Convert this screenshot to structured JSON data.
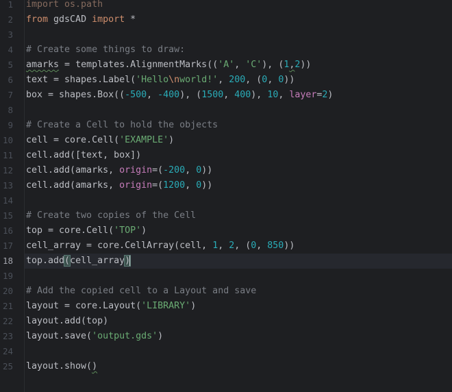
{
  "editor": {
    "current_line": 18,
    "lines": [
      {
        "n": "1",
        "tokens": [
          {
            "t": "import os.path",
            "c": "kw-soft"
          }
        ]
      },
      {
        "n": "2",
        "tokens": [
          {
            "t": "from",
            "c": "kw"
          },
          {
            "t": " gdsCAD ",
            "c": ""
          },
          {
            "t": "import",
            "c": "kw"
          },
          {
            "t": " *",
            "c": ""
          }
        ]
      },
      {
        "n": "3",
        "tokens": []
      },
      {
        "n": "4",
        "tokens": [
          {
            "t": "# Create some things to draw:",
            "c": "cmt"
          }
        ]
      },
      {
        "n": "5",
        "tokens": [
          {
            "t": "amarks",
            "c": "squig"
          },
          {
            "t": " = templates.AlignmentMarks((",
            "c": ""
          },
          {
            "t": "'A'",
            "c": "str"
          },
          {
            "t": ", ",
            "c": ""
          },
          {
            "t": "'C'",
            "c": "str"
          },
          {
            "t": "), (",
            "c": ""
          },
          {
            "t": "1",
            "c": "num"
          },
          {
            "t": ",",
            "c": "squig"
          },
          {
            "t": "2",
            "c": "num"
          },
          {
            "t": "))",
            "c": ""
          }
        ]
      },
      {
        "n": "6",
        "tokens": [
          {
            "t": "text = shapes.Label(",
            "c": ""
          },
          {
            "t": "'Hello",
            "c": "str"
          },
          {
            "t": "\\n",
            "c": "esc"
          },
          {
            "t": "world!'",
            "c": "str"
          },
          {
            "t": ", ",
            "c": ""
          },
          {
            "t": "200",
            "c": "num"
          },
          {
            "t": ", (",
            "c": ""
          },
          {
            "t": "0",
            "c": "num"
          },
          {
            "t": ", ",
            "c": ""
          },
          {
            "t": "0",
            "c": "num"
          },
          {
            "t": "))",
            "c": ""
          }
        ]
      },
      {
        "n": "7",
        "tokens": [
          {
            "t": "box = shapes.Box((",
            "c": ""
          },
          {
            "t": "-500",
            "c": "num"
          },
          {
            "t": ", ",
            "c": ""
          },
          {
            "t": "-400",
            "c": "num"
          },
          {
            "t": "), (",
            "c": ""
          },
          {
            "t": "1500",
            "c": "num"
          },
          {
            "t": ", ",
            "c": ""
          },
          {
            "t": "400",
            "c": "num"
          },
          {
            "t": "), ",
            "c": ""
          },
          {
            "t": "10",
            "c": "num"
          },
          {
            "t": ", ",
            "c": ""
          },
          {
            "t": "layer",
            "c": "param"
          },
          {
            "t": "=",
            "c": ""
          },
          {
            "t": "2",
            "c": "num"
          },
          {
            "t": ")",
            "c": ""
          }
        ]
      },
      {
        "n": "8",
        "tokens": []
      },
      {
        "n": "9",
        "tokens": [
          {
            "t": "# Create a Cell to hold the objects",
            "c": "cmt"
          }
        ]
      },
      {
        "n": "10",
        "tokens": [
          {
            "t": "cell = core.Cell(",
            "c": ""
          },
          {
            "t": "'EXAMPLE'",
            "c": "str"
          },
          {
            "t": ")",
            "c": ""
          }
        ]
      },
      {
        "n": "11",
        "tokens": [
          {
            "t": "cell.add([text, box])",
            "c": ""
          }
        ]
      },
      {
        "n": "12",
        "tokens": [
          {
            "t": "cell.add(amarks, ",
            "c": ""
          },
          {
            "t": "origin",
            "c": "param"
          },
          {
            "t": "=(",
            "c": ""
          },
          {
            "t": "-200",
            "c": "num"
          },
          {
            "t": ", ",
            "c": ""
          },
          {
            "t": "0",
            "c": "num"
          },
          {
            "t": "))",
            "c": ""
          }
        ]
      },
      {
        "n": "13",
        "tokens": [
          {
            "t": "cell.add(amarks, ",
            "c": ""
          },
          {
            "t": "origin",
            "c": "param"
          },
          {
            "t": "=(",
            "c": ""
          },
          {
            "t": "1200",
            "c": "num"
          },
          {
            "t": ", ",
            "c": ""
          },
          {
            "t": "0",
            "c": "num"
          },
          {
            "t": "))",
            "c": ""
          }
        ]
      },
      {
        "n": "14",
        "tokens": []
      },
      {
        "n": "15",
        "tokens": [
          {
            "t": "# Create two copies of the Cell",
            "c": "cmt"
          }
        ]
      },
      {
        "n": "16",
        "tokens": [
          {
            "t": "top = core.Cell(",
            "c": ""
          },
          {
            "t": "'TOP'",
            "c": "str"
          },
          {
            "t": ")",
            "c": ""
          }
        ]
      },
      {
        "n": "17",
        "tokens": [
          {
            "t": "cell_array = core.CellArray(cell, ",
            "c": ""
          },
          {
            "t": "1",
            "c": "num"
          },
          {
            "t": ", ",
            "c": ""
          },
          {
            "t": "2",
            "c": "num"
          },
          {
            "t": ", (",
            "c": ""
          },
          {
            "t": "0",
            "c": "num"
          },
          {
            "t": ", ",
            "c": ""
          },
          {
            "t": "850",
            "c": "num"
          },
          {
            "t": "))",
            "c": ""
          }
        ]
      },
      {
        "n": "18",
        "tokens": [
          {
            "t": "top.add",
            "c": ""
          },
          {
            "t": "(",
            "c": "bracket-match"
          },
          {
            "t": "cell_array",
            "c": ""
          },
          {
            "t": ")",
            "c": "bracket-match"
          },
          {
            "t": "",
            "c": "caret"
          }
        ]
      },
      {
        "n": "19",
        "tokens": []
      },
      {
        "n": "20",
        "tokens": [
          {
            "t": "# Add the copied cell to a Layout and save",
            "c": "cmt"
          }
        ]
      },
      {
        "n": "21",
        "tokens": [
          {
            "t": "layout = core.Layout(",
            "c": ""
          },
          {
            "t": "'LIBRARY'",
            "c": "str"
          },
          {
            "t": ")",
            "c": ""
          }
        ]
      },
      {
        "n": "22",
        "tokens": [
          {
            "t": "layout.add(top)",
            "c": ""
          }
        ]
      },
      {
        "n": "23",
        "tokens": [
          {
            "t": "layout.save(",
            "c": ""
          },
          {
            "t": "'output.gds'",
            "c": "str"
          },
          {
            "t": ")",
            "c": ""
          }
        ]
      },
      {
        "n": "24",
        "tokens": []
      },
      {
        "n": "25",
        "tokens": [
          {
            "t": "layout.show(",
            "c": ""
          },
          {
            "t": ")",
            "c": "squig"
          }
        ]
      }
    ]
  },
  "colors": {
    "background": "#1e1f22",
    "line_number": "#4b5059",
    "keyword": "#cf8e6d",
    "string": "#6aab73",
    "number": "#2aacb8",
    "comment": "#7a7e85",
    "parameter": "#c77dbb",
    "text": "#bcbec4"
  }
}
